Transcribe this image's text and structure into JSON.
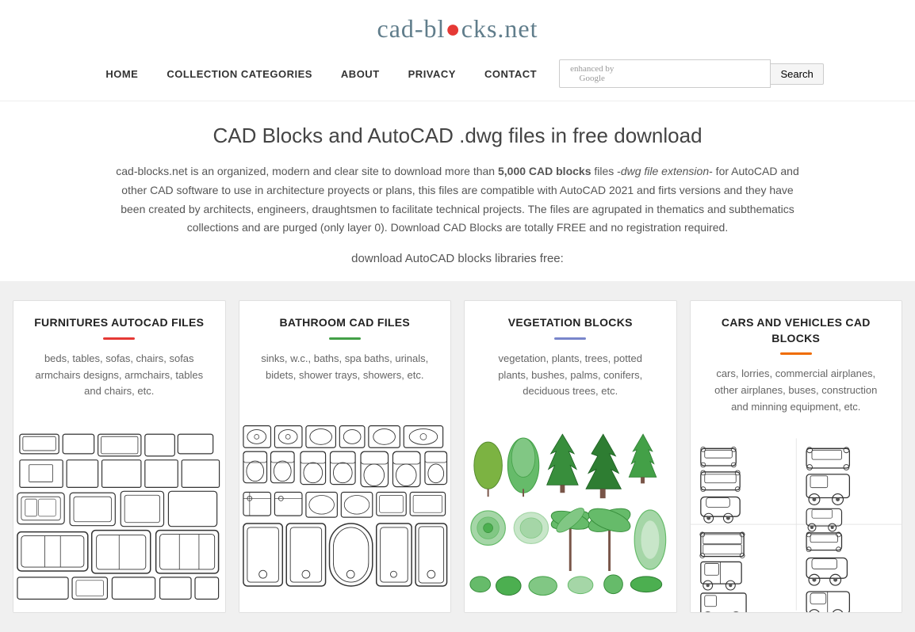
{
  "site": {
    "title": "cad-bl●cks.net",
    "title_display": "cad-blocks.net"
  },
  "nav": {
    "items": [
      {
        "label": "HOME",
        "id": "home"
      },
      {
        "label": "COLLECTION CATEGORIES",
        "id": "collection-categories"
      },
      {
        "label": "ABOUT",
        "id": "about"
      },
      {
        "label": "PRIVACY",
        "id": "privacy"
      },
      {
        "label": "CONTACT",
        "id": "contact"
      }
    ],
    "search_placeholder": "enhanced by Google",
    "search_button_label": "Search"
  },
  "hero": {
    "title": "CAD Blocks and AutoCAD .dwg files in free download",
    "description_intro": "cad-blocks.net is an organized, modern and clear site to download more than ",
    "description_bold": "5,000 CAD blocks",
    "description_middle": " files -",
    "description_italic": "dwg file extension",
    "description_rest": "- for AutoCAD and other CAD software to use in architecture proyects or plans, this files are compatible with AutoCAD 2021 and firts versions and they have been created by architects, engineers, draughtsmen to facilitate technical projects. The files are agrupated in thematics and subthematics collections and are purged (only layer 0). Download CAD Blocks are totally FREE and no registration required.",
    "subtitle": "download AutoCAD blocks libraries free:"
  },
  "cards": [
    {
      "id": "furnitures",
      "title": "FURNITURES AUTOCAD FILES",
      "underline_color": "#e53935",
      "description": "beds, tables, sofas, chairs, sofas armchairs designs, armchairs, tables and chairs, etc."
    },
    {
      "id": "bathroom",
      "title": "BATHROOM CAD FILES",
      "underline_color": "#43a047",
      "description": "sinks, w.c., baths, spa baths, urinals, bidets, shower trays, showers, etc."
    },
    {
      "id": "vegetation",
      "title": "VEGETATION BLOCKS",
      "underline_color": "#7986cb",
      "description": "vegetation, plants, trees, potted plants, bushes, palms, conifers, deciduous trees, etc."
    },
    {
      "id": "cars",
      "title": "CARS AND VEHICLES CAD BLOCKS",
      "underline_color": "#ef6c00",
      "description": "cars, lorries, commercial airplanes, other airplanes, buses, construction and minning equipment, etc."
    }
  ]
}
